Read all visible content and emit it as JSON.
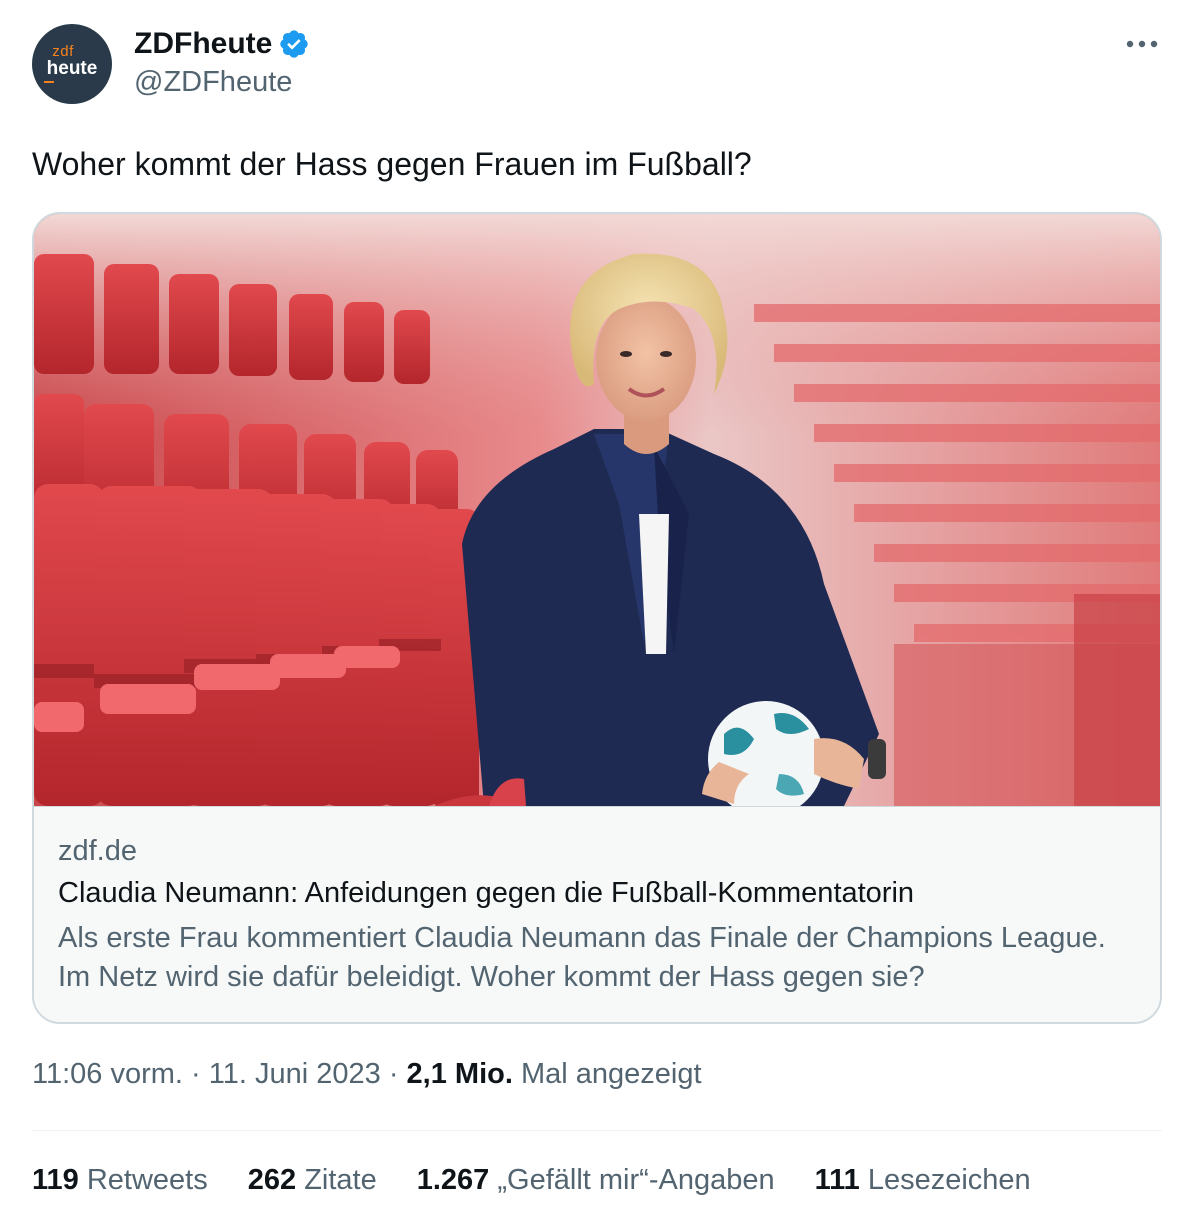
{
  "author": {
    "avatar_text_top": "zdf",
    "avatar_text_bottom": "heute",
    "display_name": "ZDFheute",
    "handle": "@ZDFheute"
  },
  "tweet": {
    "text": "Woher kommt der Hass gegen Frauen im Fußball?"
  },
  "card": {
    "domain": "zdf.de",
    "title": "Claudia Neumann: Anfeidungen gegen die Fußball-Kommentatorin",
    "description": "Als erste Frau kommentiert Claudia Neumann das Finale der Champions League. Im Netz wird sie dafür beleidigt. Woher kommt der Hass gegen sie?"
  },
  "meta": {
    "time": "11:06 vorm.",
    "separator1": " · ",
    "date": "11. Juni 2023",
    "separator2": " · ",
    "views": "2,1 Mio.",
    "views_label": " Mal angezeigt"
  },
  "stats": [
    {
      "value": "119",
      "label": " Retweets"
    },
    {
      "value": "262",
      "label": " Zitate"
    },
    {
      "value": "1.267",
      "label": " „Gefällt mir“-Angaben"
    },
    {
      "value": "111",
      "label": " Lesezeichen"
    }
  ],
  "colors": {
    "verified": "#1d9bf0",
    "avatar_bg": "#2a3a4a",
    "avatar_accent": "#f7821b",
    "secondary_text": "#536471",
    "border": "#cfd9de"
  },
  "icons": {
    "verified": "verified-badge-icon",
    "more": "more-icon"
  }
}
